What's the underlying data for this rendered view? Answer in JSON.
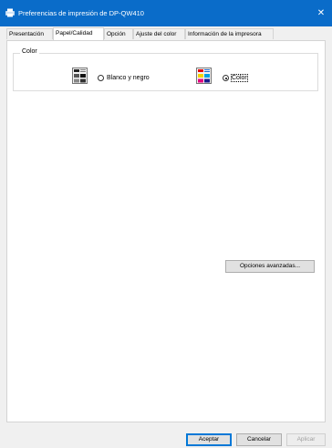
{
  "window": {
    "title": "Preferencias de impresión de DP-QW410",
    "close_label": "✕",
    "title_icon": "printer-icon"
  },
  "tabs": [
    {
      "label": "Presentación"
    },
    {
      "label": "Papel/Calidad"
    },
    {
      "label": "Opción"
    },
    {
      "label": "Ajuste del color"
    },
    {
      "label": "Información de la impresora"
    }
  ],
  "active_tab": "Papel/Calidad",
  "color_group": {
    "label": "Color",
    "options": [
      {
        "label": "Blanco y negro",
        "selected": false,
        "icon": "bw-document-icon"
      },
      {
        "label": "Color",
        "selected": true,
        "icon": "color-document-icon"
      }
    ]
  },
  "advanced_button": "Opciones avanzadas...",
  "footer": {
    "ok": "Aceptar",
    "cancel": "Cancelar",
    "apply": "Aplicar"
  },
  "colors": {
    "titlebar": "#0a6cc9",
    "accent": "#0078d7"
  }
}
